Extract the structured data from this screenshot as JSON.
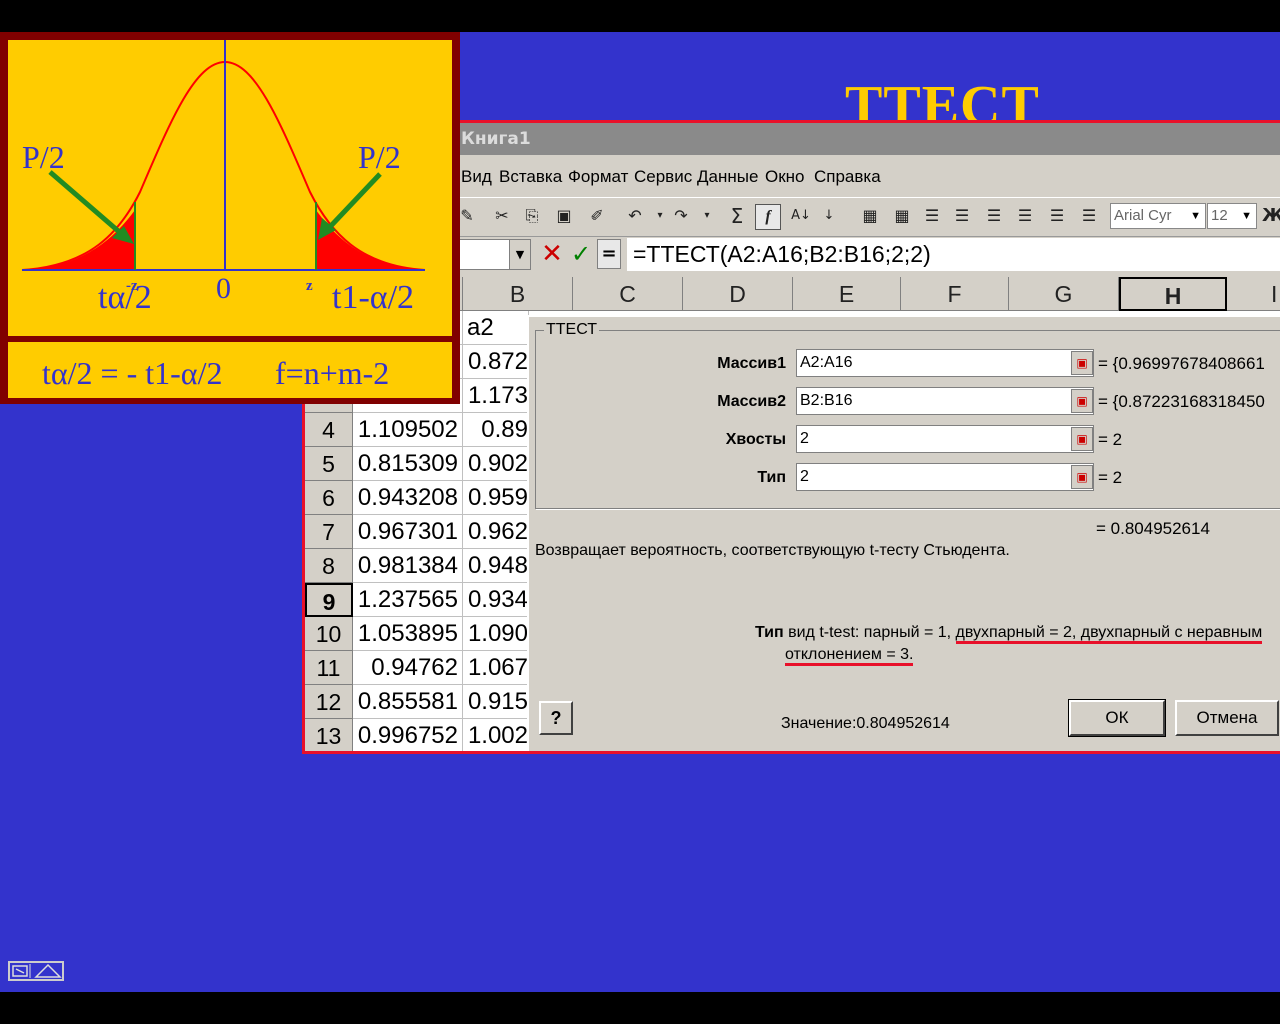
{
  "slide": {
    "title": "ТТЕСТ"
  },
  "excel": {
    "window_title": "Книга1",
    "menu": [
      "Вид",
      "Вставка",
      "Формат",
      "Сервис",
      "Данные",
      "Окно",
      "Справка"
    ],
    "toolbar": {
      "font_name": "Arial Cyr",
      "font_size": "12",
      "bold_partial": "Ж"
    },
    "formula_bar": {
      "formula": "=ТТЕСТ(A2:A16;B2:B16;2;2)",
      "cancel_icon": "x-icon",
      "enter_icon": "check-icon"
    },
    "columns": [
      "B",
      "C",
      "D",
      "E",
      "F",
      "G",
      "H",
      "I"
    ],
    "rows": [
      {
        "num": "",
        "a": "",
        "b": "a2"
      },
      {
        "num": "",
        "a": "",
        "b": "0.872"
      },
      {
        "num": "",
        "a": "",
        "b": "1.173"
      },
      {
        "num": "4",
        "a": "1.109502",
        "b": "0.89"
      },
      {
        "num": "5",
        "a": "0.815309",
        "b": "0.902"
      },
      {
        "num": "6",
        "a": "0.943208",
        "b": "0.959"
      },
      {
        "num": "7",
        "a": "0.967301",
        "b": "0.962"
      },
      {
        "num": "8",
        "a": "0.981384",
        "b": "0.948"
      },
      {
        "num": "9",
        "a": "1.237565",
        "b": "0.934"
      },
      {
        "num": "10",
        "a": "1.053895",
        "b": "1.090"
      },
      {
        "num": "11",
        "a": "0.94762",
        "b": "1.067"
      },
      {
        "num": "12",
        "a": "0.855581",
        "b": "0.915"
      },
      {
        "num": "13",
        "a": "0.996752",
        "b": "1.002"
      }
    ],
    "active_row": "9",
    "active_col": "H"
  },
  "dialog": {
    "group_label": "ТТЕСТ",
    "args": [
      {
        "label": "Массив1",
        "value": "A2:A16",
        "result": "= {0.96997678408661"
      },
      {
        "label": "Массив2",
        "value": "B2:B16",
        "result": "= {0.87223168318450"
      },
      {
        "label": "Хвосты",
        "value": "2",
        "result": "= 2"
      },
      {
        "label": "Тип",
        "value": "2",
        "result": "= 2"
      }
    ],
    "total": "= 0.804952614",
    "description": "Возвращает вероятность, соответствующую t-тесту Стьюдента.",
    "arg_desc_name": "Тип",
    "arg_desc_a": " вид t-test: парный = 1, ",
    "arg_desc_b": "двухпарный = 2, двухпарный с неравным",
    "arg_desc_c": "отклонением = 3.",
    "value_text": "Значение:0.804952614",
    "help_label": "?",
    "ok_label": "ОК",
    "cancel_label": "Отмена"
  },
  "diagram": {
    "left_arrow_label": "P/2",
    "right_arrow_label": "P/2",
    "zero_label": "0",
    "left_tick": "-z",
    "right_tick": "z",
    "left_t_label": "tα/2",
    "right_t_label": "t1-α/2",
    "formula_left": "tα/2 = - t1-α/2",
    "formula_right": "f=n+m-2"
  },
  "colors": {
    "slide_bg": "#3333cc",
    "title": "#ffcc00",
    "panel_bg": "#ffcc00",
    "panel_border": "#800000",
    "curve": "#ff0000",
    "arrow": "#228b22",
    "axis": "#3333cc",
    "highlight_border": "#e8102a"
  },
  "nav_icon": "navigation-icon"
}
